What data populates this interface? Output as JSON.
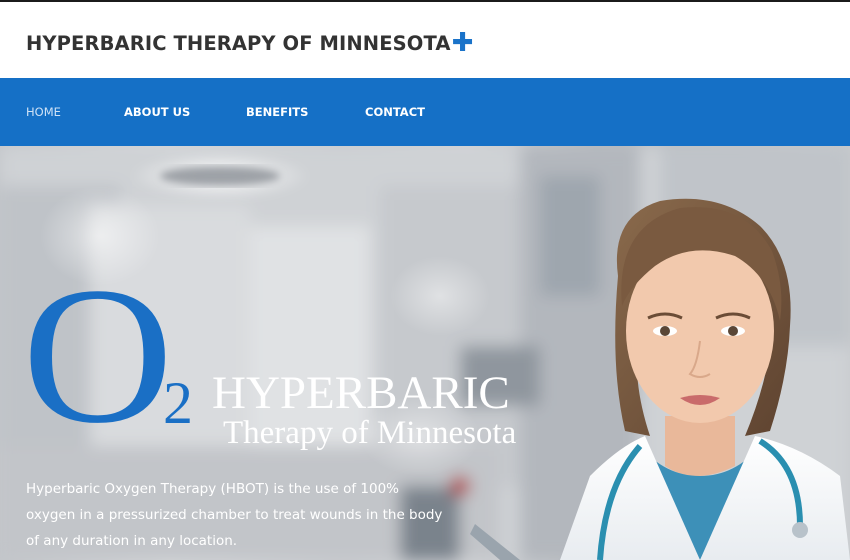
{
  "header": {
    "site_title": "HYPERBARIC THERAPY OF MINNESOTA",
    "title_plus": "✚"
  },
  "nav": {
    "items": [
      {
        "label": "HOME"
      },
      {
        "label": "ABOUT US"
      },
      {
        "label": "BENEFITS"
      },
      {
        "label": "CONTACT"
      }
    ]
  },
  "hero": {
    "logo_letter": "O",
    "logo_subscript": "2",
    "logo_title": "HYPERBARIC",
    "logo_subtitle": "Therapy of Minnesota",
    "description": "Hyperbaric Oxygen Therapy (HBOT) is the use of 100% oxygen in a pressurized chamber to treat wounds in the body of any duration in any location."
  },
  "colors": {
    "nav_bg": "#1570c6",
    "accent": "#1a73c9",
    "title_text": "#333333"
  }
}
